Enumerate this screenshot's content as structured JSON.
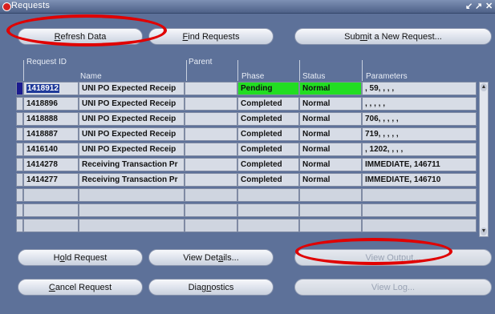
{
  "window": {
    "title": "Requests",
    "controls": [
      "↙",
      "↗",
      "✕"
    ]
  },
  "toolbar": {
    "refresh": {
      "pre": "",
      "u": "R",
      "post": "efresh Data"
    },
    "find": {
      "pre": "",
      "u": "F",
      "post": "ind Requests"
    },
    "submit": {
      "pre": "Sub",
      "u": "m",
      "post": "it a New Request..."
    }
  },
  "headers": {
    "request_id": "Request ID",
    "name": "Name",
    "parent": "Parent",
    "phase": "Phase",
    "status": "Status",
    "parameters": "Parameters"
  },
  "rows": [
    {
      "request_id": "1418912",
      "name": "UNI PO Expected Receip",
      "parent": "",
      "phase": "Pending",
      "status": "Normal",
      "parameters": ", 59, , , ,"
    },
    {
      "request_id": "1418896",
      "name": "UNI PO Expected Receip",
      "parent": "",
      "phase": "Completed",
      "status": "Normal",
      "parameters": ", , , , ,"
    },
    {
      "request_id": "1418888",
      "name": "UNI PO Expected Receip",
      "parent": "",
      "phase": "Completed",
      "status": "Normal",
      "parameters": "706, , , , ,"
    },
    {
      "request_id": "1418887",
      "name": "UNI PO Expected Receip",
      "parent": "",
      "phase": "Completed",
      "status": "Normal",
      "parameters": "719, , , , ,"
    },
    {
      "request_id": "1416140",
      "name": "UNI PO Expected Receip",
      "parent": "",
      "phase": "Completed",
      "status": "Normal",
      "parameters": ", 1202, , , ,"
    },
    {
      "request_id": "1414278",
      "name": "Receiving Transaction Pr",
      "parent": "",
      "phase": "Completed",
      "status": "Normal",
      "parameters": "IMMEDIATE, 146711"
    },
    {
      "request_id": "1414277",
      "name": "Receiving Transaction Pr",
      "parent": "",
      "phase": "Completed",
      "status": "Normal",
      "parameters": "IMMEDIATE, 146710"
    }
  ],
  "empty_row_count": 3,
  "actions": {
    "hold": {
      "pre": "H",
      "u": "o",
      "post": "ld Request"
    },
    "details": {
      "pre": "View Det",
      "u": "a",
      "post": "ils..."
    },
    "output": {
      "pre": "View Outp",
      "u": "u",
      "post": "t..."
    },
    "cancel": {
      "pre": "",
      "u": "C",
      "post": "ancel Request"
    },
    "diagnostics": {
      "pre": "Diag",
      "u": "n",
      "post": "ostics"
    },
    "log": {
      "pre": "View Lo",
      "u": "g",
      "post": "..."
    }
  },
  "colors": {
    "background": "#5d7199",
    "pending_highlight": "#22dd22",
    "selection": "#1f3a9a",
    "annotation_oval": "#e00000"
  }
}
